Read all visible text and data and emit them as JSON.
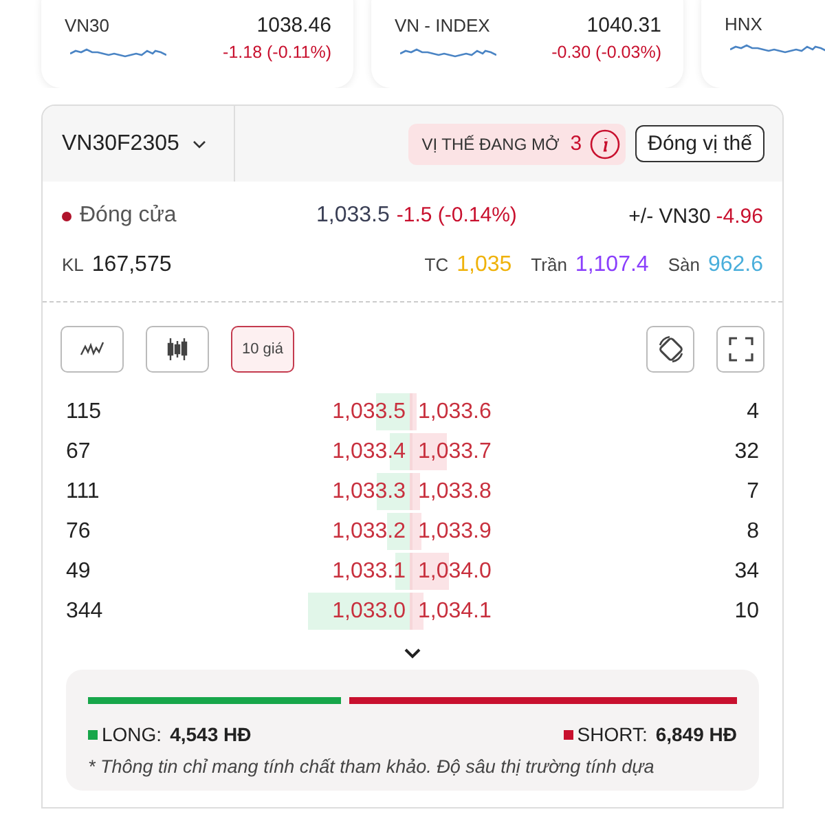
{
  "indices": [
    {
      "name": "VN30",
      "value": "1038.46",
      "change": "-1.18 (-0.11%)"
    },
    {
      "name": "VN - INDEX",
      "value": "1040.31",
      "change": "-0.30 (-0.03%)"
    },
    {
      "name": "HNX"
    }
  ],
  "contract": {
    "symbol": "VN30F2305",
    "open_positions": {
      "label": "VỊ THẾ ĐANG MỞ",
      "count": "3"
    },
    "close_button": "Đóng vị thế"
  },
  "quote": {
    "status": "Đóng cửa",
    "price": "1,033.5",
    "change": "-1.5 (-0.14%)",
    "basis_label": "+/- VN30",
    "basis": "-4.96",
    "volume_label": "KL",
    "volume": "167,575",
    "ref_label": "TC",
    "ref": "1,035",
    "ceiling_label": "Trần",
    "ceiling": "1,107.4",
    "floor_label": "Sàn",
    "floor": "962.6"
  },
  "toolbar": {
    "views": [
      {
        "kind": "line",
        "selected": false
      },
      {
        "kind": "candle",
        "selected": false
      },
      {
        "kind": "text",
        "label": "10 giá",
        "selected": true
      }
    ],
    "tools": [
      {
        "kind": "rotate"
      },
      {
        "kind": "fullscreen"
      }
    ]
  },
  "order_book": [
    {
      "bid": {
        "qty": "115",
        "price": "1,033.5"
      },
      "ask": {
        "price": "1,033.6",
        "qty": "4"
      }
    },
    {
      "bid": {
        "qty": "67",
        "price": "1,033.4"
      },
      "ask": {
        "price": "1,033.7",
        "qty": "32"
      }
    },
    {
      "bid": {
        "qty": "111",
        "price": "1,033.3"
      },
      "ask": {
        "price": "1,033.8",
        "qty": "7"
      }
    },
    {
      "bid": {
        "qty": "76",
        "price": "1,033.2"
      },
      "ask": {
        "price": "1,033.9",
        "qty": "8"
      }
    },
    {
      "bid": {
        "qty": "49",
        "price": "1,033.1"
      },
      "ask": {
        "price": "1,034.0",
        "qty": "34"
      }
    },
    {
      "bid": {
        "qty": "344",
        "price": "1,033.0"
      },
      "ask": {
        "price": "1,034.1",
        "qty": "10"
      }
    }
  ],
  "balance": {
    "long": {
      "label": "LONG:",
      "value": "4,543 HĐ",
      "level": 0.39
    },
    "short": {
      "label": "SHORT:",
      "value": "6,849 HĐ"
    }
  },
  "note": "* Thông tin chỉ mang tính chất tham khảo. Độ sâu thị trường tính dựa"
}
